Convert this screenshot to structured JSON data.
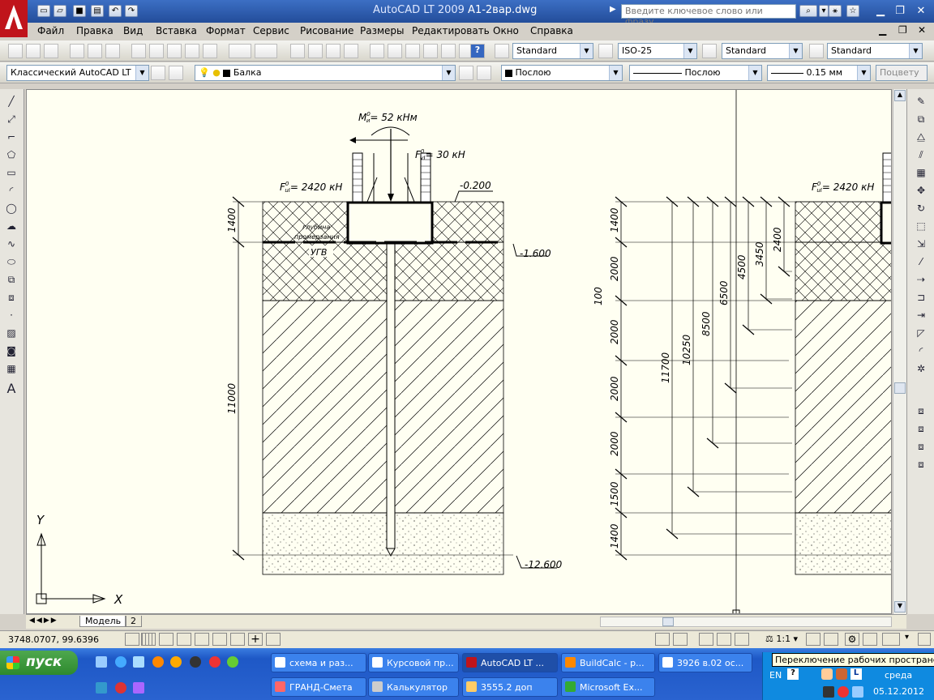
{
  "titlebar": {
    "app_name": "AutoCAD LT 2009",
    "file_name": "A1-2вар.dwg",
    "search_placeholder": "Введите ключевое слово или фразу"
  },
  "menu": [
    "Файл",
    "Правка",
    "Вид",
    "Вставка",
    "Формат",
    "Сервис",
    "Рисование",
    "Размеры",
    "Редактировать",
    "Окно",
    "Справка"
  ],
  "toolbar_styles": {
    "text_style": "Standard",
    "dim_style": "ISO-25",
    "table_style": "Standard",
    "multileader_style": "Standard"
  },
  "toolbar_layers": {
    "workspace": "Классический AutoCAD LT",
    "layer": "Балка",
    "color": "Послою",
    "linetype": "Послою",
    "lineweight": "0.15 мм",
    "plot_style": "Поцвету"
  },
  "drawing": {
    "moment_label": "M",
    "moment_value": "= 52 кНм",
    "shear_label": "F",
    "shear_value": "= 30 кН",
    "load_label": "F",
    "load_value": "= 2420 кН",
    "load_label_right": "F",
    "load_value_right": "= 2420 кН",
    "superscript": "0",
    "sub_u": "и",
    "sub_vI": "vI",
    "sub_uI": "uI",
    "elev_top": "-0.200",
    "elev_mid": "-1.600",
    "elev_bot": "-12.600",
    "frost_line1": "глубина",
    "frost_line2": "промерзания",
    "groundwater": "УГВ",
    "left_dims": [
      "1400",
      "11000"
    ],
    "right_dims": [
      "1400",
      "2000",
      "100",
      "2000",
      "2000",
      "2000",
      "1500",
      "1400"
    ],
    "right_cumulative": [
      "11700",
      "10250",
      "8500",
      "6500",
      "4500",
      "3450",
      "2400"
    ],
    "ucs_y": "Y",
    "ucs_x": "X"
  },
  "tabs": {
    "model": "Модель",
    "layout2": "2"
  },
  "status": {
    "coords": "3748.0707, 99.6396",
    "scale": "1:1"
  },
  "taskbar": {
    "start": "пуск",
    "tasks_row1": [
      "схема и раз...",
      "Курсовой пр...",
      "AutoCAD LT ...",
      "BuildCalc - р...",
      "3926 в.02 ос..."
    ],
    "tasks_row2": [
      "ГРАНД-Смета",
      "Калькулятор",
      "3555.2   доп",
      "Microsoft Ex..."
    ],
    "lang": "EN",
    "day": "среда",
    "date": "05.12.2012",
    "tooltip": "Переключение рабочих пространств"
  },
  "colors": {
    "titlebar": "#2a58a8",
    "canvas": "#fffff2",
    "taskbar": "#245edb",
    "start": "#3c9a3c"
  }
}
